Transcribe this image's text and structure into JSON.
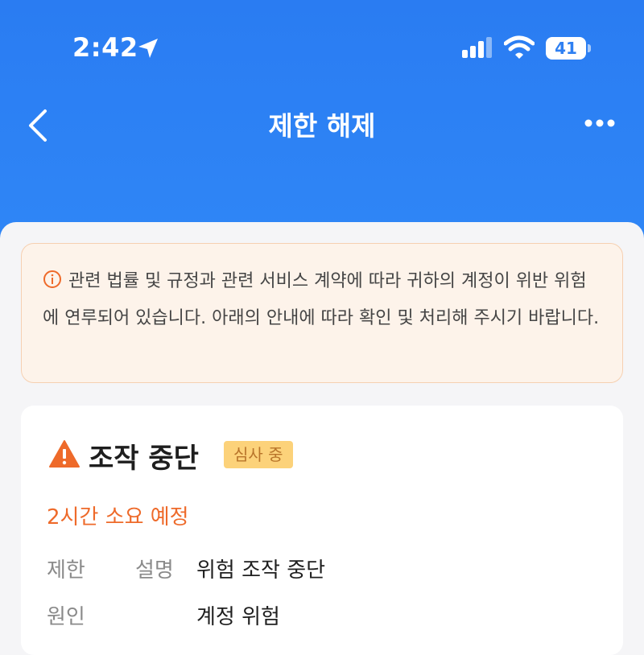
{
  "status_bar": {
    "time": "2:42",
    "battery": "41"
  },
  "nav": {
    "title": "제한 해제"
  },
  "notice": {
    "text": "관련 법률 및 규정과 관련 서비스 계약에 따라 귀하의 계정이 위반 위험에 연루되어 있습니다. 아래의 안내에 따라 확인 및 처리해 주시기 바랍니다."
  },
  "card": {
    "title": "조작 중단",
    "status": "심사 중",
    "eta": "2시간 소요 예정",
    "rows": [
      {
        "label": "제한",
        "label2": "설명",
        "value": "위험 조작 중단"
      },
      {
        "label": "원인",
        "label2": "",
        "value": "계정 위험"
      }
    ]
  },
  "colors": {
    "header_blue": "#2f86f6",
    "warning_orange": "#ee6a2a",
    "badge_yellow": "#fcd27a"
  },
  "icons": [
    "location-arrow-icon",
    "signal-icon",
    "wifi-icon",
    "battery-icon",
    "back-chevron-icon",
    "more-icon",
    "info-icon",
    "warning-icon"
  ]
}
